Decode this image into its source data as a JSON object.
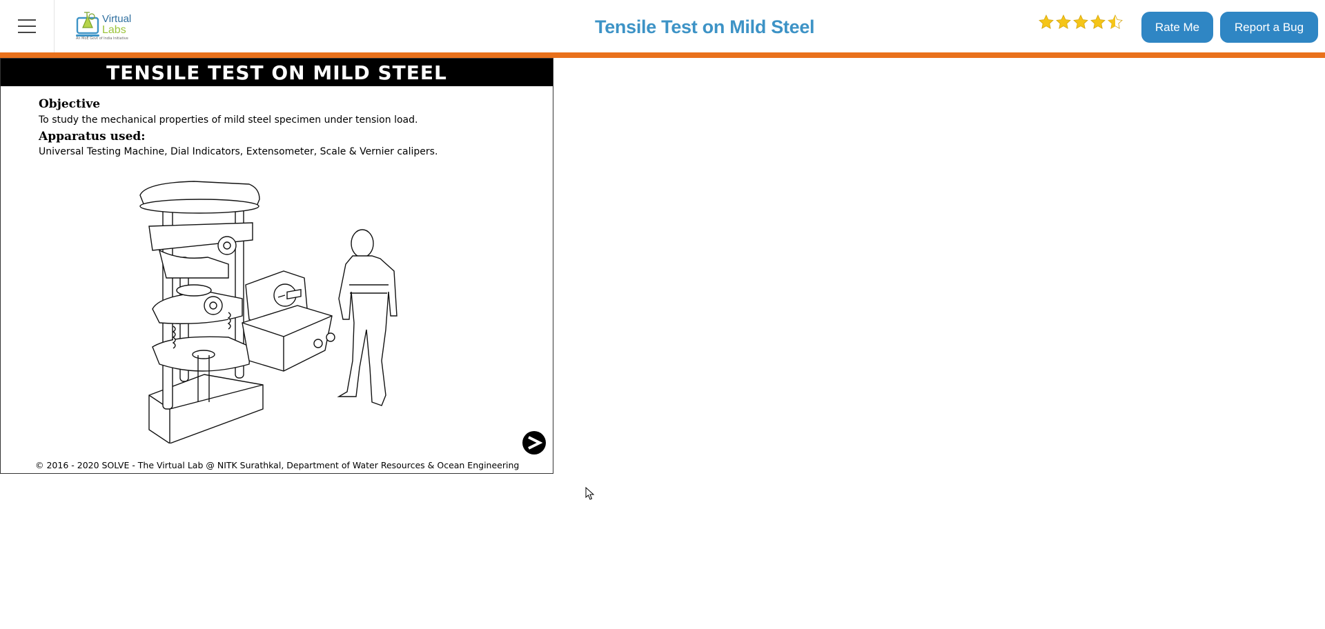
{
  "navbar": {
    "menu_icon": "hamburger-menu-icon",
    "logo": {
      "line1": "Virtual",
      "line2": "Labs",
      "tagline": "An MoE Govt of India Initiative"
    },
    "title": "Tensile Test on Mild Steel",
    "rating": {
      "value": 4.5,
      "max": 5,
      "icon": "star-icon"
    },
    "rate_label": "Rate Me",
    "bug_label": "Report a Bug",
    "colors": {
      "accent": "#e9711c",
      "button": "#2f86c4",
      "title": "#3d93c6",
      "star": "#f5c518"
    }
  },
  "experiment": {
    "header": "TENSILE TEST ON MILD STEEL",
    "objective_heading": "Objective",
    "objective_text": "To study the mechanical properties of mild steel specimen under tension load.",
    "apparatus_heading": "Apparatus used:",
    "apparatus_text": "Universal Testing Machine, Dial Indicators, Extensometer, Scale & Vernier calipers.",
    "figure": "universal-testing-machine-illustration",
    "next_icon": "next-arrow-icon",
    "footer": "© 2016 - 2020 SOLVE - The Virtual Lab @ NITK Surathkal, Department of Water Resources & Ocean Engineering"
  }
}
